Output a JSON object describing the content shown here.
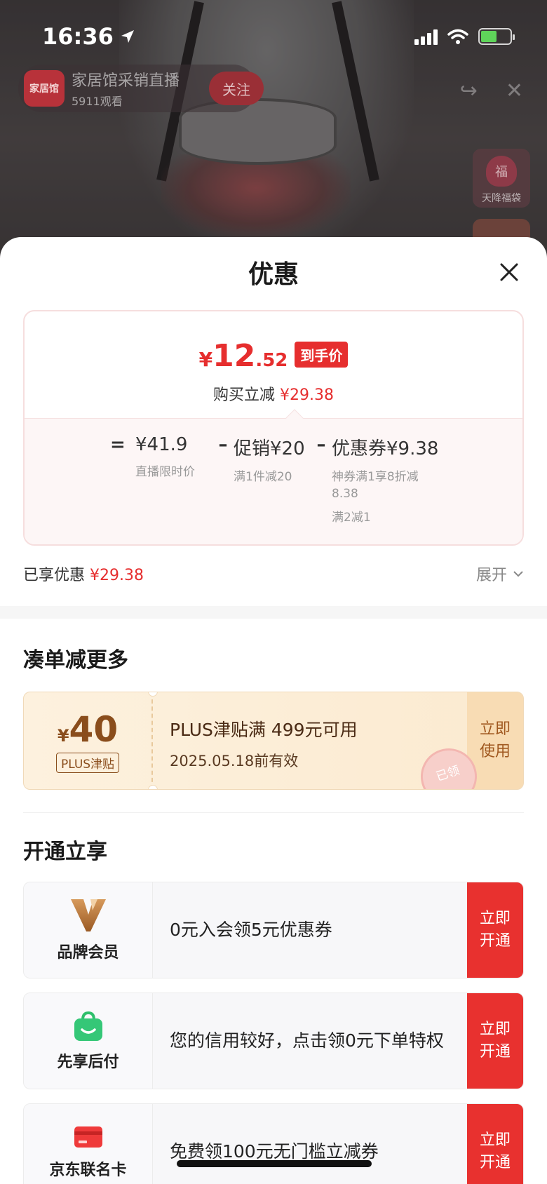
{
  "status_bar": {
    "time": "16:36"
  },
  "live": {
    "host_name": "家居馆采销直播",
    "views": "5911观看",
    "follow_label": "关注",
    "logo_text": "家居馆",
    "gift_label": "天降福袋",
    "gift_char": "福"
  },
  "sheet": {
    "title": "优惠",
    "price": {
      "currency": "¥",
      "integer": "12",
      "decimal": ".52",
      "tag": "到手价",
      "save_prefix": "购买立减",
      "save_amount": "¥29.38"
    },
    "formula": {
      "equals": "=",
      "base": {
        "value": "¥41.9",
        "note": "直播限时价"
      },
      "promo": {
        "value": "促销¥20",
        "note": "满1件减20"
      },
      "coupon": {
        "value": "优惠券¥9.38",
        "note1": "神券满1享8折减",
        "note2": "8.38",
        "note3": "满2减1"
      },
      "minus": "–"
    },
    "enjoyed": {
      "label": "已享优惠",
      "amount": "¥29.38",
      "expand": "展开"
    },
    "more_section": {
      "title": "凑单减更多",
      "coupon": {
        "currency": "¥",
        "amount": "40",
        "badge": "PLUS津贴",
        "line1": "PLUS津贴满 499元可用",
        "line2": "2025.05.18前有效",
        "button": "立即使用",
        "stamp": "已领"
      }
    },
    "open_section": {
      "title": "开通立享",
      "items": [
        {
          "name": "品牌会员",
          "desc": "0元入会领5元优惠券",
          "button": "立即开通",
          "icon": "brand-v-icon"
        },
        {
          "name": "先享后付",
          "desc": "您的信用较好，点击领0元下单特权",
          "button": "立即开通",
          "icon": "shopping-bag-icon"
        },
        {
          "name": "京东联名卡",
          "desc": "免费领100元无门槛立减券",
          "button": "立即开通",
          "icon": "credit-card-icon"
        }
      ]
    }
  },
  "colors": {
    "accent_red": "#e62e2e",
    "coupon_brown": "#8a4d1c",
    "button_red": "#e8312f"
  }
}
